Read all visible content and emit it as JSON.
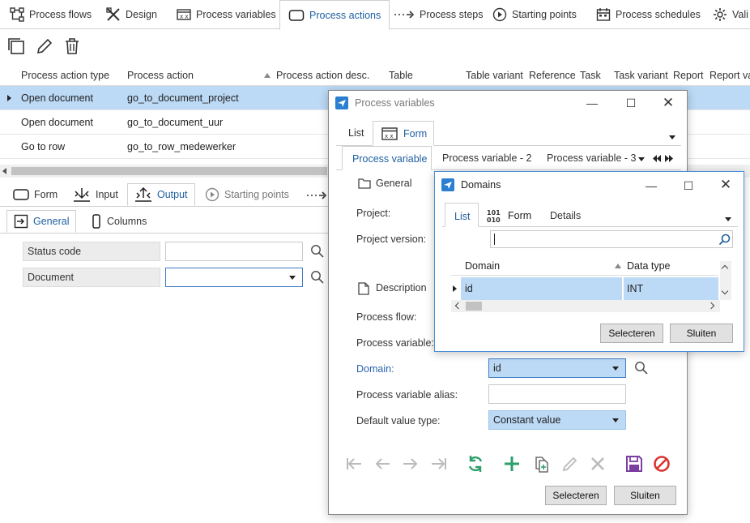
{
  "top_tabs": [
    {
      "label": "Process flows",
      "icon": "process-flows-icon"
    },
    {
      "label": "Design",
      "icon": "design-icon"
    },
    {
      "label": "Process variables",
      "icon": "process-variables-icon"
    },
    {
      "label": "Process actions",
      "icon": "process-actions-icon",
      "active": true
    },
    {
      "label": "Process steps",
      "icon": "process-steps-icon"
    },
    {
      "label": "Starting points",
      "icon": "starting-points-icon"
    },
    {
      "label": "Process schedules",
      "icon": "process-schedules-icon"
    },
    {
      "label": "Vali",
      "icon": "validations-icon"
    }
  ],
  "grid": {
    "columns": [
      "Process action type",
      "Process action",
      "Process action desc.",
      "Table",
      "Table variant",
      "Reference",
      "Task",
      "Task variant",
      "Report",
      "Report va"
    ],
    "rows": [
      {
        "type": "Open document",
        "action": "go_to_document_project",
        "selected": true
      },
      {
        "type": "Open document",
        "action": "go_to_document_uur"
      },
      {
        "type": "Go to row",
        "action": "go_to_row_medewerker"
      }
    ]
  },
  "detail_tabs": [
    "Form",
    "Input",
    "Output",
    "Starting points"
  ],
  "sub_tabs": [
    "General",
    "Columns"
  ],
  "fields": {
    "status_code": "Status code",
    "document": "Document"
  },
  "pv_window": {
    "title": "Process variables",
    "tabs": [
      "List",
      "Form"
    ],
    "record_tabs": [
      "Process variable",
      "Process variable - 2",
      "Process variable - 3"
    ],
    "sections": {
      "general": "General",
      "description": "Description"
    },
    "labels": {
      "project": "Project:",
      "project_version": "Project version:",
      "process_flow": "Process flow:",
      "process_variable": "Process variable:",
      "domain": "Domain:",
      "alias": "Process variable alias:",
      "default_value_type": "Default value type:"
    },
    "values": {
      "domain": "id",
      "default_value_type": "Constant value"
    },
    "buttons": {
      "select": "Selecteren",
      "close": "Sluiten"
    }
  },
  "domains_window": {
    "title": "Domains",
    "tabs": [
      "List",
      "Form",
      "Details"
    ],
    "columns": [
      "Domain",
      "Data type"
    ],
    "rows": [
      {
        "domain": "id",
        "data_type": "INT"
      }
    ],
    "buttons": {
      "select": "Selecteren",
      "close": "Sluiten"
    }
  },
  "colors": {
    "accent": "#1f5fa0",
    "selection": "#bcd9f5",
    "green": "#2e9e6a",
    "purple": "#7a3fa0",
    "red": "#d9332f"
  }
}
